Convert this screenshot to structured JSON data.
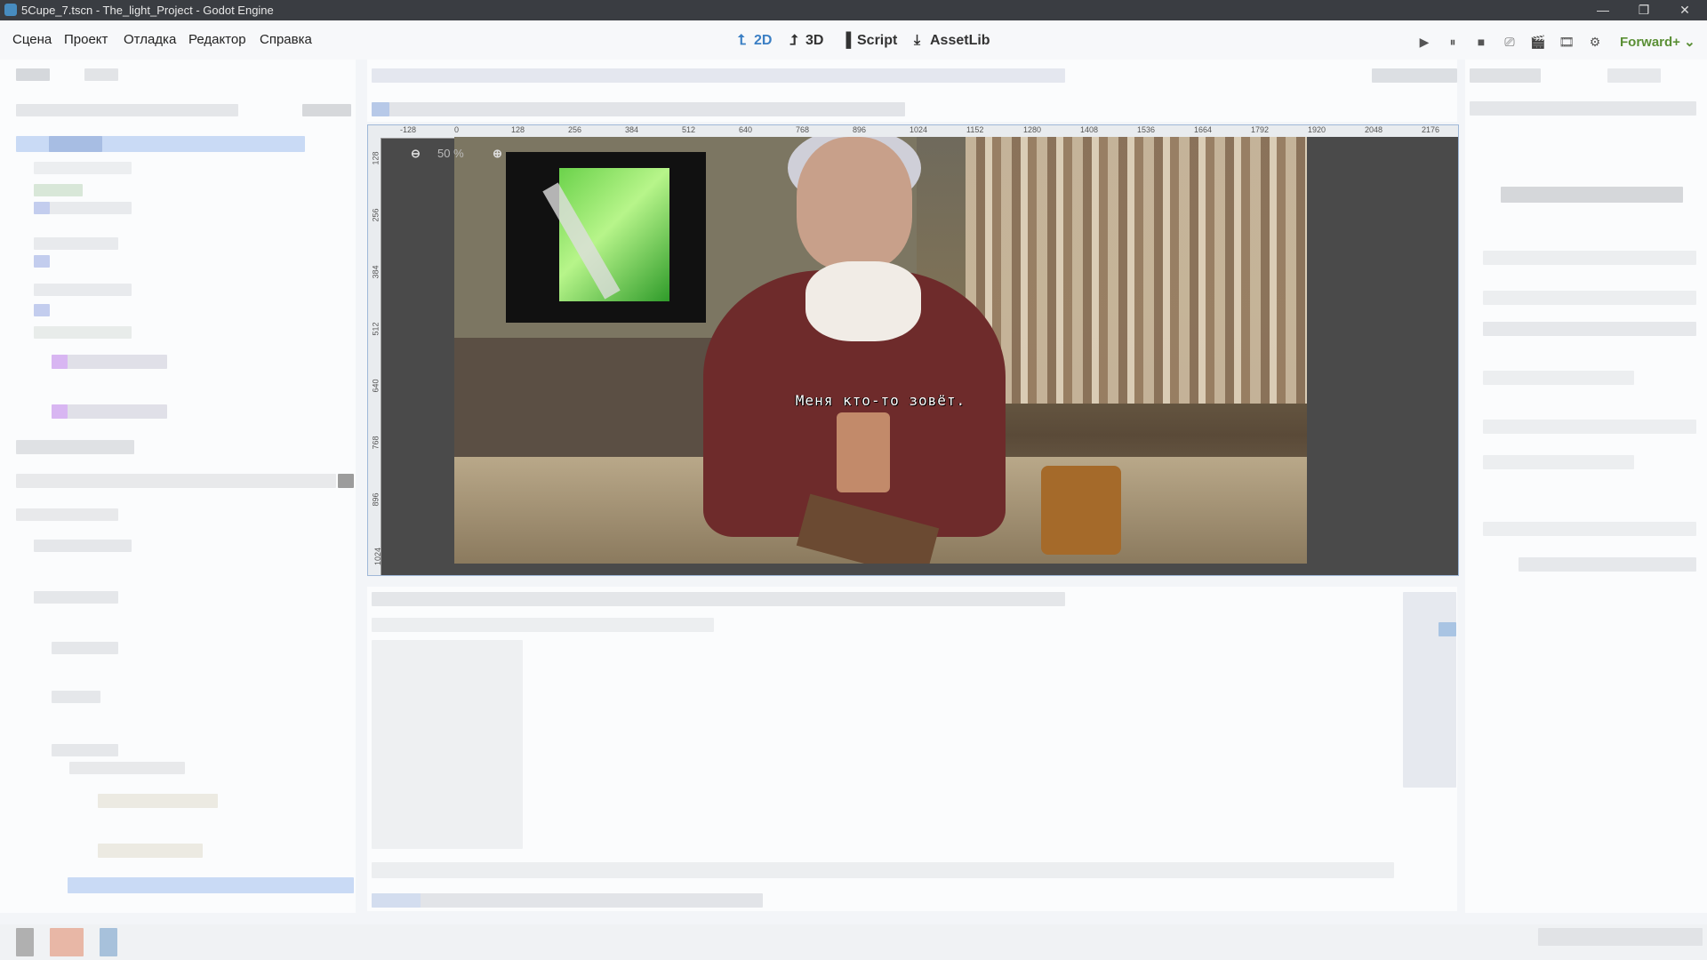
{
  "window": {
    "title": "5Cupe_7.tscn - The_light_Project - Godot Engine",
    "controls": [
      "—",
      "❐",
      "✕"
    ]
  },
  "menu": {
    "items": [
      "Сцена",
      "Проект",
      "Отладка",
      "Редактор",
      "Справка"
    ]
  },
  "workspaces": {
    "tabs": [
      {
        "label": "2D",
        "active": true
      },
      {
        "label": "3D",
        "active": false
      },
      {
        "label": "Script",
        "active": false
      },
      {
        "label": "AssetLib",
        "active": false
      }
    ]
  },
  "run_controls": [
    "▶",
    "⏸",
    "■",
    "⎚",
    "🎬",
    "🎞",
    "⚙"
  ],
  "renderer": {
    "label": "Forward+"
  },
  "viewport": {
    "zoom_label": "50 %",
    "ruler_h": [
      "-128",
      "0",
      "128",
      "256",
      "384",
      "512",
      "640",
      "768",
      "896",
      "1024",
      "1152",
      "1280",
      "1408",
      "1536",
      "1664",
      "1792",
      "1920",
      "2048",
      "2176"
    ],
    "ruler_v": [
      "128",
      "256",
      "384",
      "512",
      "640",
      "768",
      "896",
      "1024"
    ],
    "dialog_text": "Меня кто-то зовёт."
  },
  "colors": {
    "accent": "#3b7fc4",
    "renderer": "#5a8f35",
    "titlebar": "#3a3d42"
  }
}
